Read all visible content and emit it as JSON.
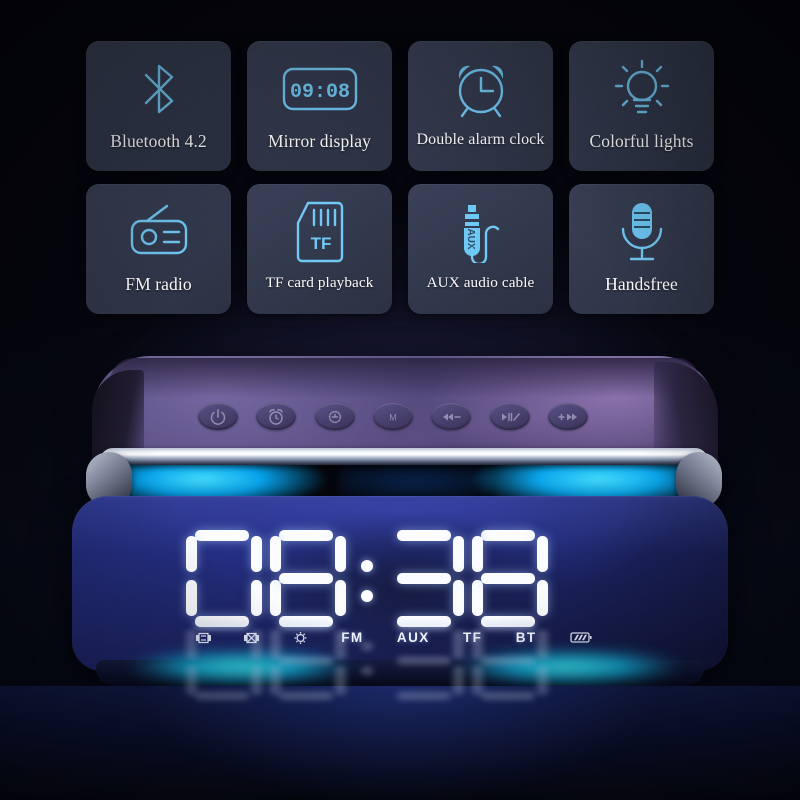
{
  "background": {
    "color": "#05060d",
    "accent_cyan": "#35d6ff",
    "accent_purple": "#5b4d82"
  },
  "features": {
    "row1": [
      {
        "label": "Bluetooth 4.2",
        "icon": "bluetooth-icon"
      },
      {
        "label": "Mirror display",
        "icon": "digital-clock-display-icon",
        "icon_text": "09:08"
      },
      {
        "label": "Double alarm clock",
        "icon": "alarm-clock-icon"
      },
      {
        "label": "Colorful lights",
        "icon": "lightbulb-icon"
      }
    ],
    "row2": [
      {
        "label": "FM radio",
        "icon": "radio-icon"
      },
      {
        "label": "TF card playback",
        "icon": "tf-card-icon",
        "icon_text": "TF"
      },
      {
        "label": "AUX audio cable",
        "icon": "aux-jack-icon",
        "icon_text": "AUX"
      },
      {
        "label": "Handsfree",
        "icon": "microphone-icon"
      }
    ]
  },
  "device": {
    "buttons": [
      {
        "name": "power-button",
        "icon": "power-icon"
      },
      {
        "name": "alarm-button",
        "icon": "alarm-icon"
      },
      {
        "name": "brightness-button",
        "icon": "brightness-icon"
      },
      {
        "name": "mode-button",
        "icon": "mode-icon",
        "label": "M"
      },
      {
        "name": "previous-volume-down-button",
        "icon": "previous-icon"
      },
      {
        "name": "play-pause-button",
        "icon": "play-pause-icon"
      },
      {
        "name": "next-volume-up-button",
        "icon": "next-icon"
      }
    ],
    "display": {
      "time": "08:38",
      "hours": "08",
      "minutes": "38",
      "separator": ":",
      "digit_color": "#fafcff",
      "panel_color": "#242e80",
      "status": [
        {
          "name": "alarm-1-indicator",
          "icon": "alarm-1-icon"
        },
        {
          "name": "alarm-2-indicator",
          "icon": "alarm-2-icon"
        },
        {
          "name": "brightness-indicator",
          "icon": "brightness-icon"
        },
        {
          "name": "fm-indicator",
          "label": "FM"
        },
        {
          "name": "aux-indicator",
          "label": "AUX"
        },
        {
          "name": "tf-indicator",
          "label": "TF"
        },
        {
          "name": "bt-indicator",
          "label": "BT"
        },
        {
          "name": "battery-indicator",
          "icon": "battery-icon"
        }
      ]
    }
  }
}
